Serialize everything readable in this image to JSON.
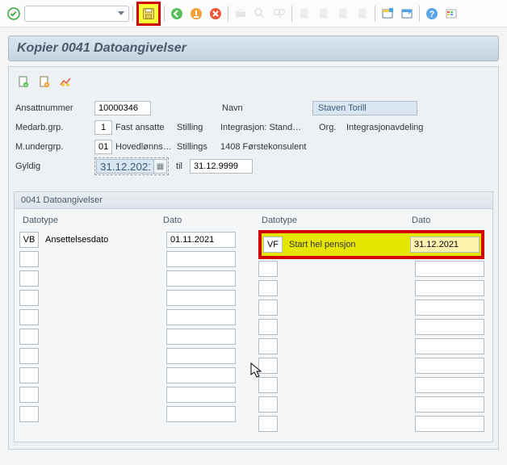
{
  "title": "Kopier 0041 Datoangivelser",
  "toolbar": {
    "dropdown": ""
  },
  "form": {
    "ansatt_label": "Ansattnummer",
    "ansatt_value": "10000346",
    "navn_label": "Navn",
    "navn_value": "Staven Torill",
    "medarb_label": "Medarb.grp.",
    "medarb_value": "1",
    "medarb_text": "Fast ansatte",
    "stilling_label": "Stilling",
    "stilling_text1": "Integrasjon: Stand…",
    "org_label": "Org.",
    "org_text": "Integrasjonavdeling",
    "mundergrp_label": "M.undergrp.",
    "mundergrp_value": "01",
    "mundergrp_text": "Hovedlønns…",
    "stillings_label": "Stillings",
    "stillings_text": "1408 Førstekonsulent",
    "gyldig_label": "Gyldig",
    "gyldig_from": "31.12.2021",
    "gyldig_til_label": "til",
    "gyldig_til": "31.12.9999"
  },
  "section": {
    "title": "0041 Datoangivelser",
    "headers": {
      "a": "Datotype",
      "b": "Dato"
    },
    "left_rows": [
      {
        "code": "VB",
        "desc": "Ansettelsesdato",
        "date": "01.11.2021"
      }
    ],
    "right_rows": [
      {
        "code": "VF",
        "desc": "Start hel pensjon",
        "date": "31.12.2021"
      }
    ],
    "empty_rows": 9
  }
}
